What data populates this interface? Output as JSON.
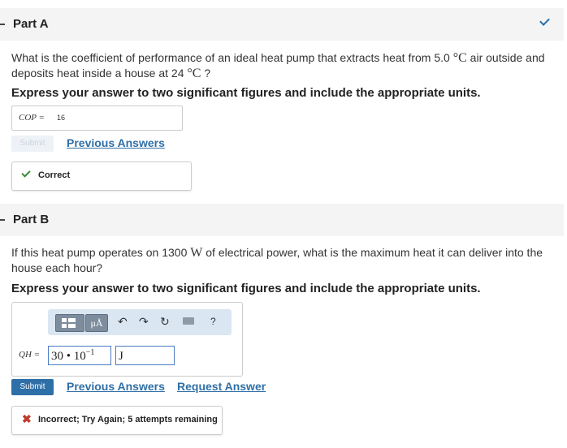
{
  "partA": {
    "title": "Part A",
    "question_pre": "What is the coefficient of performance of an ideal heat pump that extracts heat from 5.0 ",
    "question_unit1": "°C",
    "question_mid": " air outside and deposits heat inside a house at 24 ",
    "question_unit2": "°C",
    "question_post": " ?",
    "instruction": "Express your answer to two significant figures and include the appropriate units.",
    "answer_label": "COP =",
    "answer_value": "16",
    "submit_label": "Submit",
    "previous_answers": "Previous Answers",
    "feedback": "Correct"
  },
  "partB": {
    "title": "Part B",
    "question_pre": "If this heat pump operates on 1300 ",
    "question_unit": "W",
    "question_post": " of electrical power, what is the maximum heat it can deliver into the house each hour?",
    "instruction": "Express your answer to two significant figures and include the appropriate units.",
    "toolbar": {
      "units_button": "μÅ",
      "help": "?"
    },
    "answer_label": "QH =",
    "answer_mantissa": "30 • 10",
    "answer_exponent": "−1",
    "answer_unit": "J",
    "submit_label": "Submit",
    "previous_answers": "Previous Answers",
    "request_answer": "Request Answer",
    "feedback": "Incorrect; Try Again; 5 attempts remaining"
  },
  "colors": {
    "link": "#2f6fa7",
    "correct": "#3a8a3a",
    "incorrect": "#c0392b",
    "submit": "#2f6fa7"
  }
}
